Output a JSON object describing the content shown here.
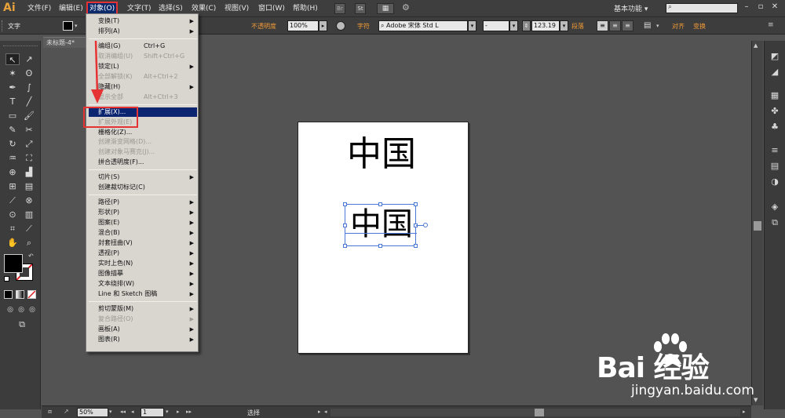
{
  "app": {
    "logo": "Ai"
  },
  "menubar": {
    "items": [
      "文件(F)",
      "编辑(E)",
      "对象(O)",
      "文字(T)",
      "选择(S)",
      "效果(C)",
      "视图(V)",
      "窗口(W)",
      "帮助(H)"
    ],
    "br_label": "Br",
    "st_label": "St",
    "workspace": "基本功能",
    "workspace_arrow": "▾"
  },
  "controlbar": {
    "tool_label": "文字",
    "opacity_label": "不透明度",
    "opacity_value": "100%",
    "char_label": "字符",
    "font_value": "Adobe 宋体 Std L",
    "style_value": "-",
    "size_value": "123.19",
    "para_label": "段落",
    "align_label": "对齐",
    "transform_label": "变换"
  },
  "document": {
    "tab_title": "未标题-4*"
  },
  "object_menu": [
    {
      "label": "变换(T)",
      "submenu": true,
      "disabled": false
    },
    {
      "label": "排列(A)",
      "submenu": true,
      "disabled": false
    },
    {
      "sep": true
    },
    {
      "label": "编组(G)",
      "shortcut": "Ctrl+G",
      "disabled": false
    },
    {
      "label": "取消编组(U)",
      "shortcut": "Shift+Ctrl+G",
      "disabled": true
    },
    {
      "label": "锁定(L)",
      "submenu": true,
      "disabled": false
    },
    {
      "label": "全部解锁(K)",
      "shortcut": "Alt+Ctrl+2",
      "disabled": true
    },
    {
      "label": "隐藏(H)",
      "submenu": true,
      "disabled": false
    },
    {
      "label": "显示全部",
      "shortcut": "Alt+Ctrl+3",
      "disabled": true
    },
    {
      "sep": true
    },
    {
      "label": "扩展(X)...",
      "disabled": false,
      "hover": true
    },
    {
      "label": "扩展外观(E)",
      "disabled": true
    },
    {
      "label": "栅格化(Z)...",
      "disabled": false
    },
    {
      "label": "创建渐变网格(D)...",
      "disabled": true
    },
    {
      "label": "创建对象马赛克(J)...",
      "disabled": true
    },
    {
      "label": "拼合透明度(F)...",
      "disabled": false
    },
    {
      "sep": true
    },
    {
      "label": "切片(S)",
      "submenu": true,
      "disabled": false
    },
    {
      "label": "创建裁切标记(C)",
      "disabled": false
    },
    {
      "sep": true
    },
    {
      "label": "路径(P)",
      "submenu": true,
      "disabled": false
    },
    {
      "label": "形状(P)",
      "submenu": true,
      "disabled": false
    },
    {
      "label": "图案(E)",
      "submenu": true,
      "disabled": false
    },
    {
      "label": "混合(B)",
      "submenu": true,
      "disabled": false
    },
    {
      "label": "封套扭曲(V)",
      "submenu": true,
      "disabled": false
    },
    {
      "label": "透视(P)",
      "submenu": true,
      "disabled": false
    },
    {
      "label": "实时上色(N)",
      "submenu": true,
      "disabled": false
    },
    {
      "label": "图像描摹",
      "submenu": true,
      "disabled": false
    },
    {
      "label": "文本绕排(W)",
      "submenu": true,
      "disabled": false
    },
    {
      "label": "Line 和 Sketch 图稿",
      "submenu": true,
      "disabled": false
    },
    {
      "sep": true
    },
    {
      "label": "剪切蒙版(M)",
      "submenu": true,
      "disabled": false
    },
    {
      "label": "复合路径(O)",
      "submenu": true,
      "disabled": true
    },
    {
      "label": "画板(A)",
      "submenu": true,
      "disabled": false
    },
    {
      "label": "图表(R)",
      "submenu": true,
      "disabled": false
    }
  ],
  "canvas": {
    "text_top": "中国",
    "text_selected": "中国"
  },
  "statusbar": {
    "zoom": "50%",
    "page": "1",
    "status": "选择"
  },
  "watermark": {
    "brand": "Bai 经验",
    "url": "jingyan.baidu.com"
  }
}
